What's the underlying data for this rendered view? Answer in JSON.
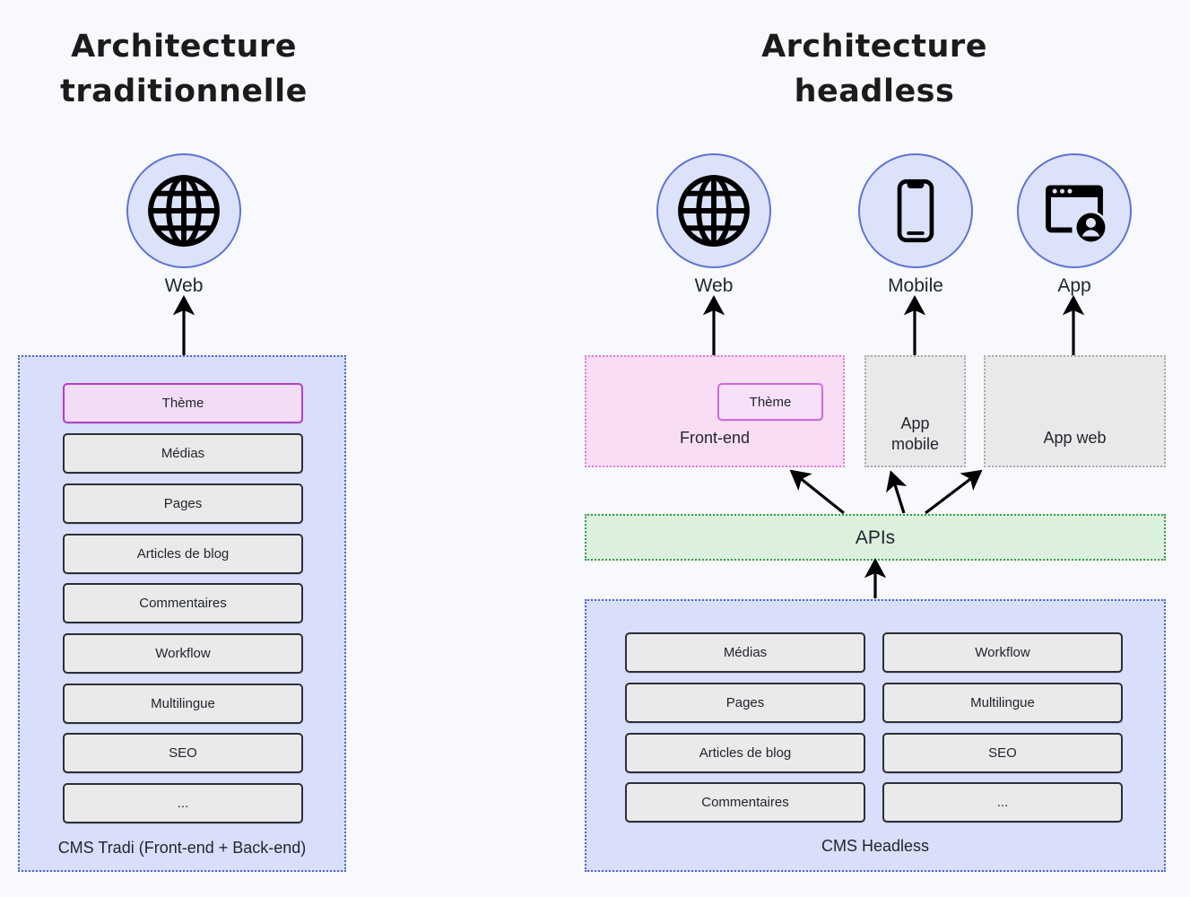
{
  "background": "#f8f9fc",
  "colors": {
    "circle_fill": "#dce2f9",
    "circle_border": "#5f72d6",
    "cms_fill": "#d9dffa",
    "cms_border": "#4c63d2",
    "frontend_fill": "#f8ddf5",
    "frontend_border": "#e07ae0",
    "grey_fill": "#e9e9ea",
    "grey_border": "#a8a8a8",
    "apis_fill": "#dbf0dd",
    "apis_border": "#3a9a4d",
    "pill_fill": "#eaeaea",
    "pill_border": "#2b2f38",
    "theme_fill": "#f3dcf5",
    "theme_border": "#b33fc6",
    "arrow": "#000000"
  },
  "left_panel": {
    "title_line1": "Architecture",
    "title_line2": "traditionnelle",
    "channels": [
      {
        "icon": "globe-icon",
        "label": "Web"
      }
    ],
    "cms": {
      "caption": "CMS Tradi (Front-end + Back-end)",
      "items": [
        {
          "label": "Thème",
          "highlight": true
        },
        {
          "label": "Médias",
          "highlight": false
        },
        {
          "label": "Pages",
          "highlight": false
        },
        {
          "label": "Articles de blog",
          "highlight": false
        },
        {
          "label": "Commentaires",
          "highlight": false
        },
        {
          "label": "Workflow",
          "highlight": false
        },
        {
          "label": "Multilingue",
          "highlight": false
        },
        {
          "label": "SEO",
          "highlight": false
        },
        {
          "label": "...",
          "highlight": false
        }
      ]
    }
  },
  "right_panel": {
    "title_line1": "Architecture",
    "title_line2": "headless",
    "channels": [
      {
        "icon": "globe-icon",
        "label": "Web"
      },
      {
        "icon": "mobile-icon",
        "label": "Mobile"
      },
      {
        "icon": "app-window-user-icon",
        "label": "App"
      }
    ],
    "consumers": [
      {
        "caption": "Front-end",
        "kind": "frontend",
        "inner_label": "Thème"
      },
      {
        "caption": "App\nmobile",
        "caption_line1": "App",
        "caption_line2": "mobile",
        "kind": "grey"
      },
      {
        "caption": "App web",
        "kind": "grey"
      }
    ],
    "apis": {
      "label": "APIs"
    },
    "cms": {
      "caption": "CMS Headless",
      "column_left": [
        {
          "label": "Médias"
        },
        {
          "label": "Pages"
        },
        {
          "label": "Articles de blog"
        },
        {
          "label": "Commentaires"
        }
      ],
      "column_right": [
        {
          "label": "Workflow"
        },
        {
          "label": "Multilingue"
        },
        {
          "label": "SEO"
        },
        {
          "label": "..."
        }
      ]
    }
  }
}
